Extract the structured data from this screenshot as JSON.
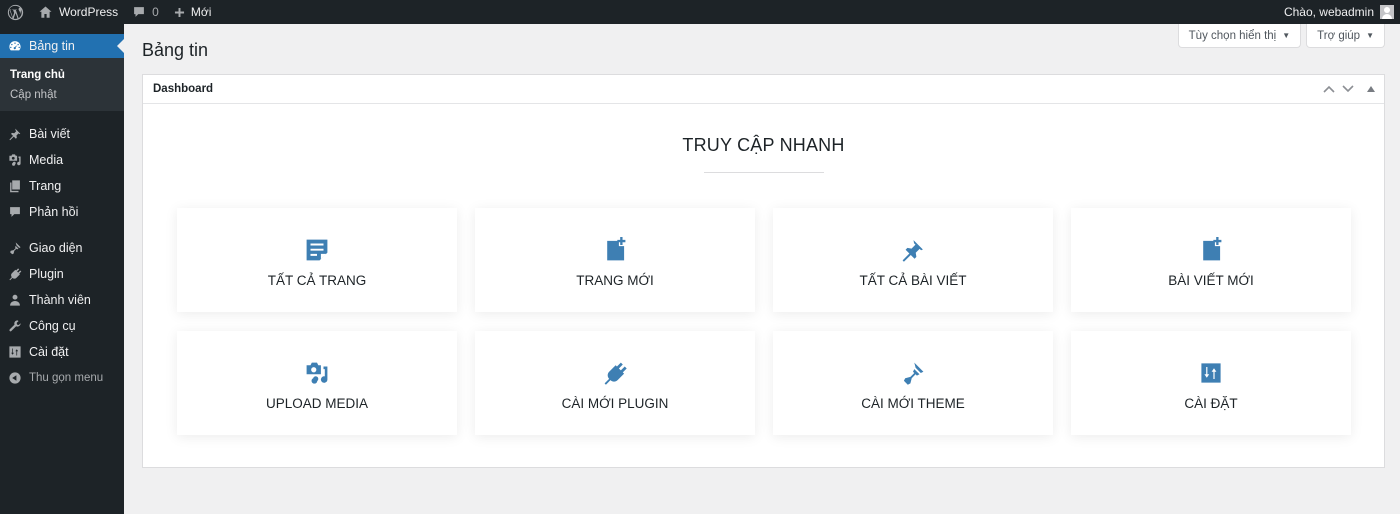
{
  "adminbar": {
    "site_name": "WordPress",
    "comments_count": "0",
    "new_label": "Mới",
    "greeting": "Chào, webadmin"
  },
  "sidebar": {
    "current": {
      "label": "Bảng tin",
      "icon": "dashboard-icon"
    },
    "submenu": [
      {
        "label": "Trang chủ",
        "current": true
      },
      {
        "label": "Cập nhật",
        "current": false
      }
    ],
    "items": [
      {
        "label": "Bài viết",
        "icon": "pin-icon"
      },
      {
        "label": "Media",
        "icon": "media-icon"
      },
      {
        "label": "Trang",
        "icon": "pages-icon"
      },
      {
        "label": "Phản hồi",
        "icon": "comment-icon"
      },
      {
        "label": "Giao diện",
        "icon": "brush-icon"
      },
      {
        "label": "Plugin",
        "icon": "plugin-icon"
      },
      {
        "label": "Thành viên",
        "icon": "user-icon"
      },
      {
        "label": "Công cụ",
        "icon": "wrench-icon"
      },
      {
        "label": "Cài đặt",
        "icon": "settings-icon"
      }
    ],
    "collapse_label": "Thu gọn menu"
  },
  "screen_options": {
    "label": "Tùy chọn hiển thị"
  },
  "help": {
    "label": "Trợ giúp"
  },
  "page": {
    "title": "Bảng tin"
  },
  "postbox": {
    "title": "Dashboard",
    "quick_access_title": "TRUY CẬP NHANH",
    "cards": [
      {
        "label": "TẤT CẢ TRANG",
        "icon": "page-list-icon"
      },
      {
        "label": "TRANG MỚI",
        "icon": "new-page-icon"
      },
      {
        "label": "TẤT CẢ BÀI VIẾT",
        "icon": "pin-icon"
      },
      {
        "label": "BÀI VIẾT MỚI",
        "icon": "new-post-icon"
      },
      {
        "label": "UPLOAD MEDIA",
        "icon": "media-icon"
      },
      {
        "label": "CÀI MỚI PLUGIN",
        "icon": "plugin-icon"
      },
      {
        "label": "CÀI MỚI THEME",
        "icon": "brush-icon"
      },
      {
        "label": "CÀI ĐẶT",
        "icon": "settings-icon"
      }
    ]
  },
  "colors": {
    "accent": "#2271b1",
    "icon_blue": "#3e7fb3",
    "admin_dark": "#1d2327"
  }
}
